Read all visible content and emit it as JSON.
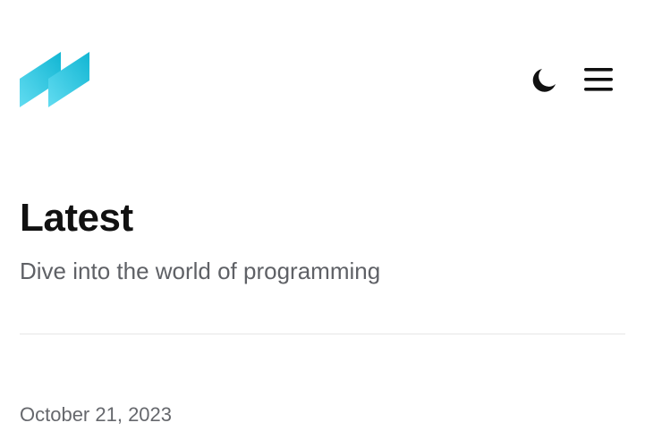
{
  "header": {
    "logo_icon": "double-slash-logo-icon",
    "theme_toggle_icon": "moon-icon",
    "menu_icon": "hamburger-menu-icon"
  },
  "main": {
    "title": "Latest",
    "subtitle": "Dive into the world of programming",
    "posts": [
      {
        "date": "October 21, 2023"
      }
    ]
  },
  "colors": {
    "text_primary": "#111111",
    "text_secondary": "#5f6166",
    "divider": "#e6e6e6",
    "logo_gradient_start": "#5ad7ee",
    "logo_gradient_end": "#14b8d4",
    "icon": "#111111"
  }
}
